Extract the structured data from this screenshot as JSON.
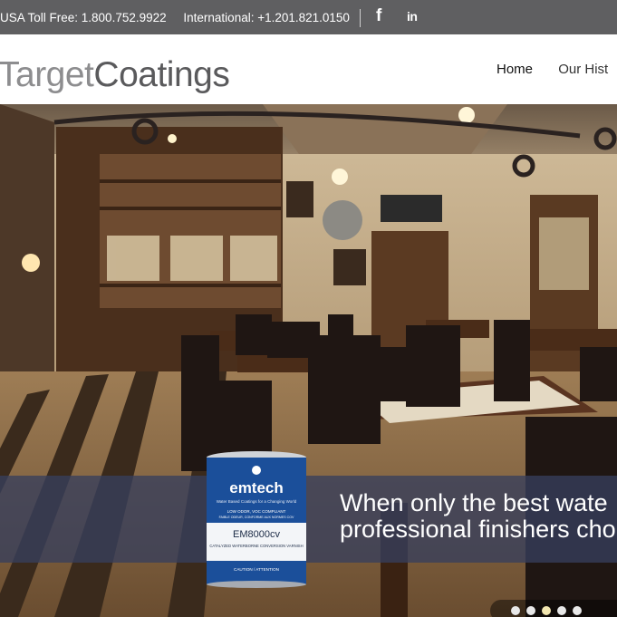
{
  "topbar": {
    "usa_phone": "USA Toll Free: 1.800.752.9922",
    "intl_phone": "International: +1.201.821.0150",
    "facebook_icon": "f",
    "linkedin_icon": "in"
  },
  "brand": {
    "word1": "Target",
    "word2": "Coatings"
  },
  "nav": {
    "items": [
      "Home",
      "Our Hist"
    ],
    "active": "Home"
  },
  "hero": {
    "tagline_line1": "When only the best wate",
    "tagline_line2": "professional finishers cho",
    "product": {
      "brand": "emtech",
      "subtitle": "Water Based Coatings for a Changing World",
      "line1": "LOW ODOR, VOC COMPLIANT",
      "line2": "FAIBLE ODEUR, CONFORME AUX NORMES COV",
      "model": "EM8000cv",
      "desc": "CATALYZED WATERBORNE CONVERSION VARNISH",
      "caution": "CAUTION / ATTENTION"
    },
    "slides": 5,
    "active_slide": 2
  },
  "colors": {
    "topbar": "#5f5f61",
    "band": "#373f5c",
    "logo_light": "#8d8d8f",
    "logo_dark": "#5a5a5c"
  }
}
